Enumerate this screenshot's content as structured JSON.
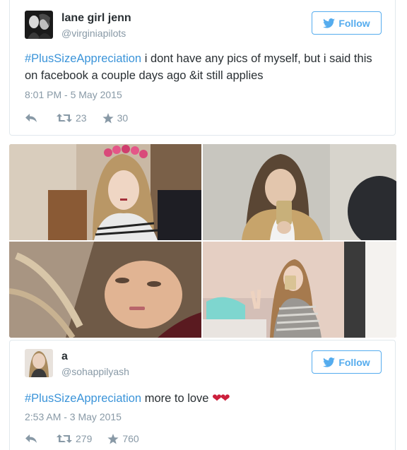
{
  "tweets": [
    {
      "display_name": "lane girl jenn",
      "handle": "@virginiapilots",
      "follow_label": "Follow",
      "hashtag": "#PlusSizeAppreciation",
      "text": " i dont have any pics of myself, but i said this on facebook a couple days ago &it still applies",
      "timestamp": "8:01 PM - 5 May 2015",
      "retweets": "23",
      "favorites": "30"
    },
    {
      "display_name": "a",
      "handle": "@sohappilyash",
      "follow_label": "Follow",
      "hashtag": "#PlusSizeAppreciation",
      "text": " more to love ",
      "hearts": "❤❤",
      "timestamp": "2:53 AM - 3 May 2015",
      "retweets": "279",
      "favorites": "760"
    }
  ],
  "icons": {
    "follow": "twitter-bird-icon",
    "reply": "reply-icon",
    "retweet": "retweet-icon",
    "favorite": "star-icon"
  },
  "colors": {
    "link": "#3b94d9",
    "follow_border": "#55acee",
    "meta_gray": "#8899a6",
    "text": "#292f33",
    "heart": "#cc1f3c"
  }
}
